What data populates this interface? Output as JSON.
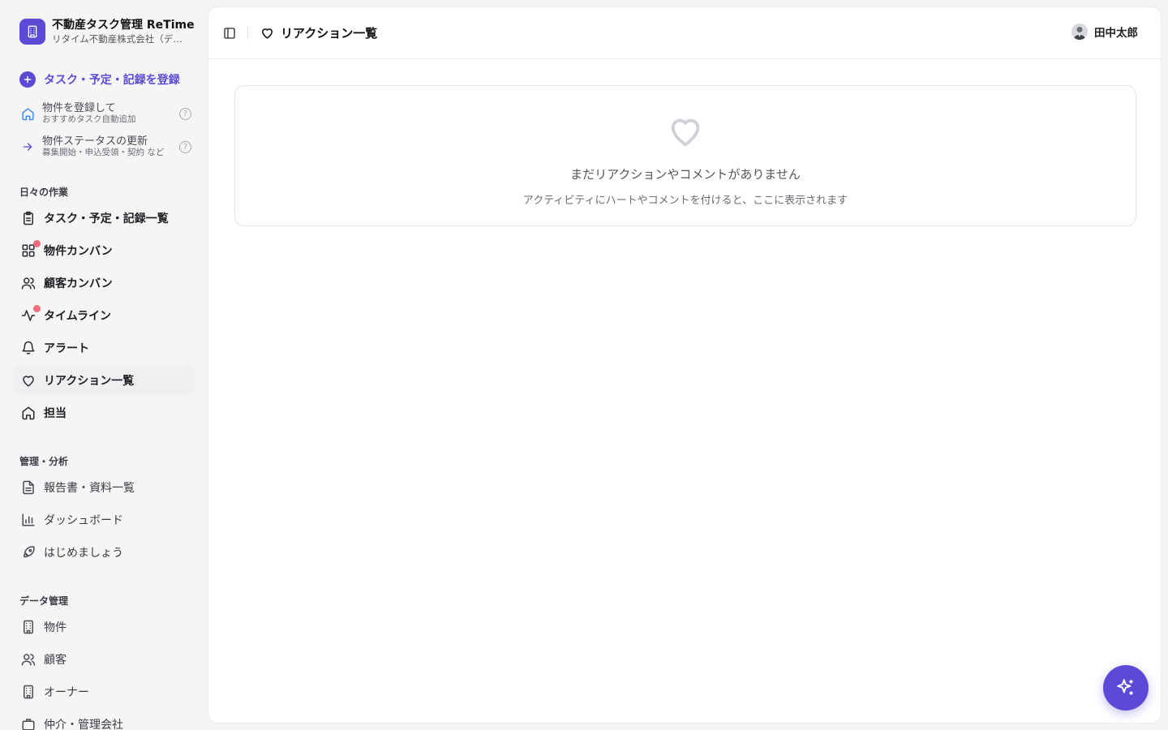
{
  "brand": {
    "title": "不動産タスク管理 ReTime",
    "subtitle": "リタイム不動産株式会社（デモ）",
    "logo_icon": "building-icon",
    "accent": "#5b4ad6"
  },
  "register": {
    "label": "タスク・予定・記録を登録",
    "icon": "plus-circle-icon"
  },
  "shortcuts": [
    {
      "title": "物件を登録して",
      "sub": "おすすめタスク自動追加",
      "icon": "home-icon"
    },
    {
      "title": "物件ステータスの更新",
      "sub": "募集開始・申込受領・契約 など",
      "icon": "arrow-right-icon"
    }
  ],
  "sections": {
    "daily": "日々の作業",
    "management": "管理・分析",
    "data": "データ管理"
  },
  "nav_daily": [
    {
      "label": "タスク・予定・記録一覧",
      "icon": "clipboard-icon"
    },
    {
      "label": "物件カンバン",
      "icon": "grid-icon",
      "badge": true
    },
    {
      "label": "顧客カンバン",
      "icon": "users-icon"
    },
    {
      "label": "タイムライン",
      "icon": "activity-icon",
      "badge": true
    },
    {
      "label": "アラート",
      "icon": "bell-icon"
    },
    {
      "label": "リアクション一覧",
      "icon": "heart-icon",
      "active": true
    },
    {
      "label": "担当",
      "icon": "home-icon"
    }
  ],
  "nav_management": [
    {
      "label": "報告書・資料一覧",
      "icon": "document-icon"
    },
    {
      "label": "ダッシュボード",
      "icon": "bar-chart-icon"
    },
    {
      "label": "はじめましょう",
      "icon": "rocket-icon"
    }
  ],
  "nav_data": [
    {
      "label": "物件",
      "icon": "building-icon"
    },
    {
      "label": "顧客",
      "icon": "users-icon"
    },
    {
      "label": "オーナー",
      "icon": "building-icon"
    },
    {
      "label": "仲介・管理会社",
      "icon": "briefcase-icon"
    }
  ],
  "header": {
    "title": "リアクション一覧",
    "user_name": "田中太郎"
  },
  "empty_state": {
    "title": "まだリアクションやコメントがありません",
    "description": "アクティビティにハートやコメントを付けると、ここに表示されます"
  },
  "fab": {
    "icon": "sparkles-icon"
  }
}
